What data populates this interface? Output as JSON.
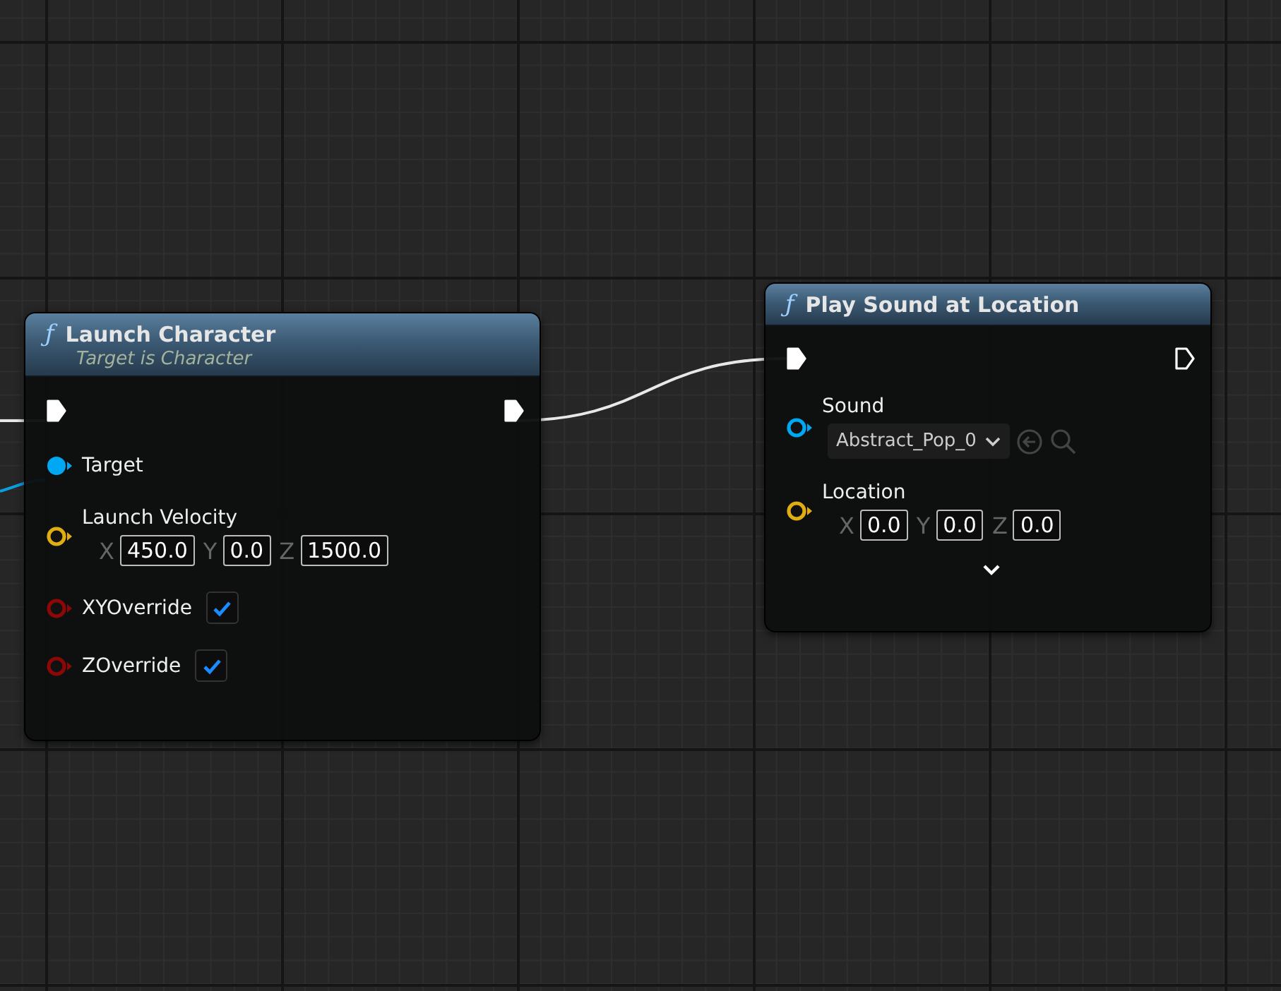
{
  "nodes": [
    {
      "icon": "ƒ",
      "title": "Launch Character",
      "subtitle": "Target is Character",
      "exec_in": {
        "connected": true
      },
      "exec_out": {
        "connected": true
      },
      "show_advanced": false,
      "pins": [
        {
          "kind": "object",
          "label": "Target",
          "connected": true
        },
        {
          "kind": "vector",
          "label": "Launch Velocity",
          "connected": false,
          "components": [
            {
              "axis": "X",
              "value": "450.0"
            },
            {
              "axis": "Y",
              "value": "0.0"
            },
            {
              "axis": "Z",
              "value": "1500.0"
            }
          ]
        },
        {
          "kind": "bool",
          "label": "XYOverride",
          "connected": false,
          "checked": true
        },
        {
          "kind": "bool",
          "label": "ZOverride",
          "connected": false,
          "checked": true
        }
      ]
    },
    {
      "icon": "ƒ",
      "title": "Play Sound at Location",
      "exec_in": {
        "connected": true
      },
      "exec_out": {
        "connected": false
      },
      "show_advanced": true,
      "pins": [
        {
          "kind": "asset",
          "label": "Sound",
          "connected": false,
          "value": "Abstract_Pop_0"
        },
        {
          "kind": "vector",
          "label": "Location",
          "connected": false,
          "components": [
            {
              "axis": "X",
              "value": "0.0"
            },
            {
              "axis": "Y",
              "value": "0.0"
            },
            {
              "axis": "Z",
              "value": "0.0"
            }
          ]
        }
      ]
    }
  ]
}
